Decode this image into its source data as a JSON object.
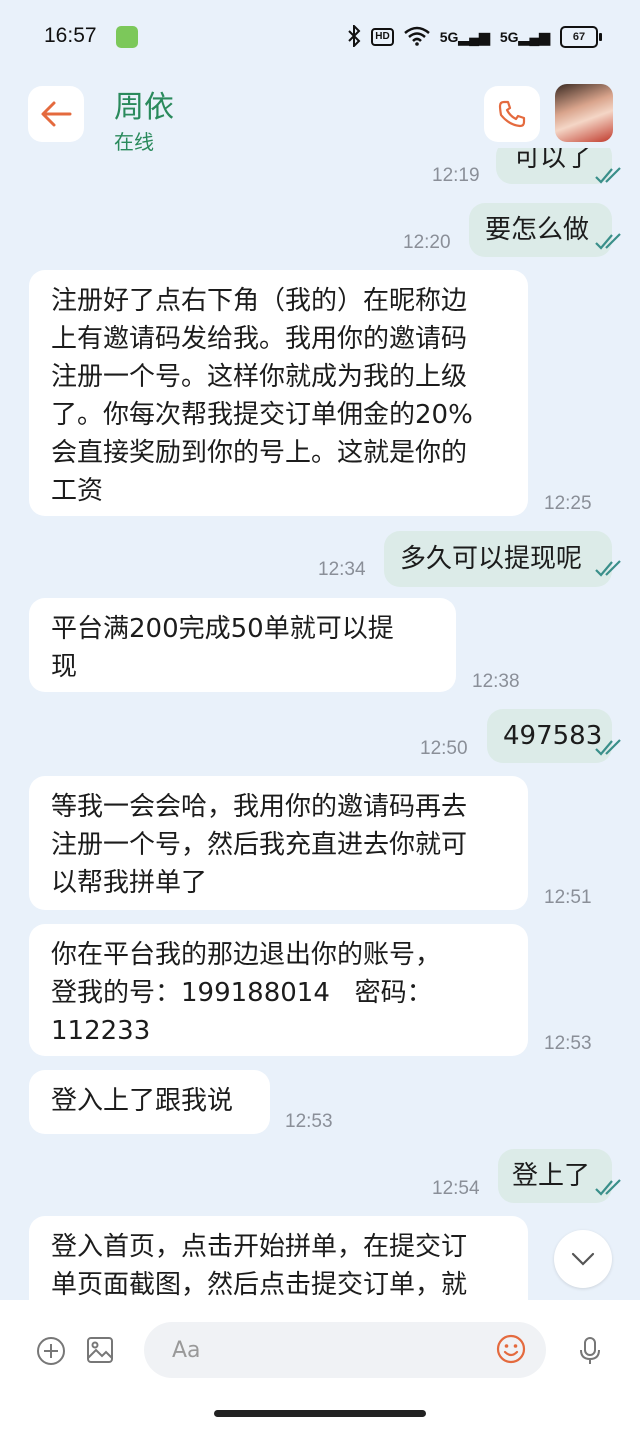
{
  "status_bar": {
    "time": "16:57",
    "network_1": "5G",
    "network_2": "5G",
    "hd": "HD",
    "battery": "67"
  },
  "header": {
    "name": "周依",
    "status": "在线"
  },
  "messages": [
    {
      "dir": "out",
      "text": "可以了",
      "time": "12:19"
    },
    {
      "dir": "out",
      "text": "要怎么做",
      "time": "12:20"
    },
    {
      "dir": "in",
      "text": "注册好了点右下角（我的）在昵称边\n上有邀请码发给我。我用你的邀请码\n注册一个号。这样你就成为我的上级\n了。你每次帮我提交订单佣金的20%\n会直接奖励到你的号上。这就是你的\n工资",
      "time": "12:25"
    },
    {
      "dir": "out",
      "text": "多久可以提现呢",
      "time": "12:34"
    },
    {
      "dir": "in",
      "text": "平台满200完成50单就可以提\n现",
      "time": "12:38"
    },
    {
      "dir": "out",
      "text": "497583",
      "time": "12:50"
    },
    {
      "dir": "in",
      "text": "等我一会会哈，我用你的邀请码再去\n注册一个号，然后我充直进去你就可\n以帮我拼单了",
      "time": "12:51"
    },
    {
      "dir": "in",
      "text": "你在平台我的那边退出你的账号，\n登我的号：199188014   密码：\n112233",
      "time": "12:53"
    },
    {
      "dir": "in",
      "text": "登入上了跟我说",
      "time": "12:53"
    },
    {
      "dir": "out",
      "text": "登上了",
      "time": "12:54"
    },
    {
      "dir": "in",
      "text": "登入首页，点击开始拼单，在提交订\n单页面截图，然后点击提交订单，就",
      "time": ""
    }
  ],
  "composer": {
    "placeholder": "Aa"
  },
  "icons": {
    "back": "back-arrow-icon",
    "call": "phone-icon",
    "add": "plus-circle-icon",
    "image": "image-icon",
    "emoji": "smiley-icon",
    "mic": "microphone-icon",
    "scroll": "chevron-down-icon"
  },
  "colors": {
    "background": "#e9f1fa",
    "accent": "#e46a3e",
    "name": "#2a8a5c",
    "outgoing_bubble": "#dcebe8"
  }
}
